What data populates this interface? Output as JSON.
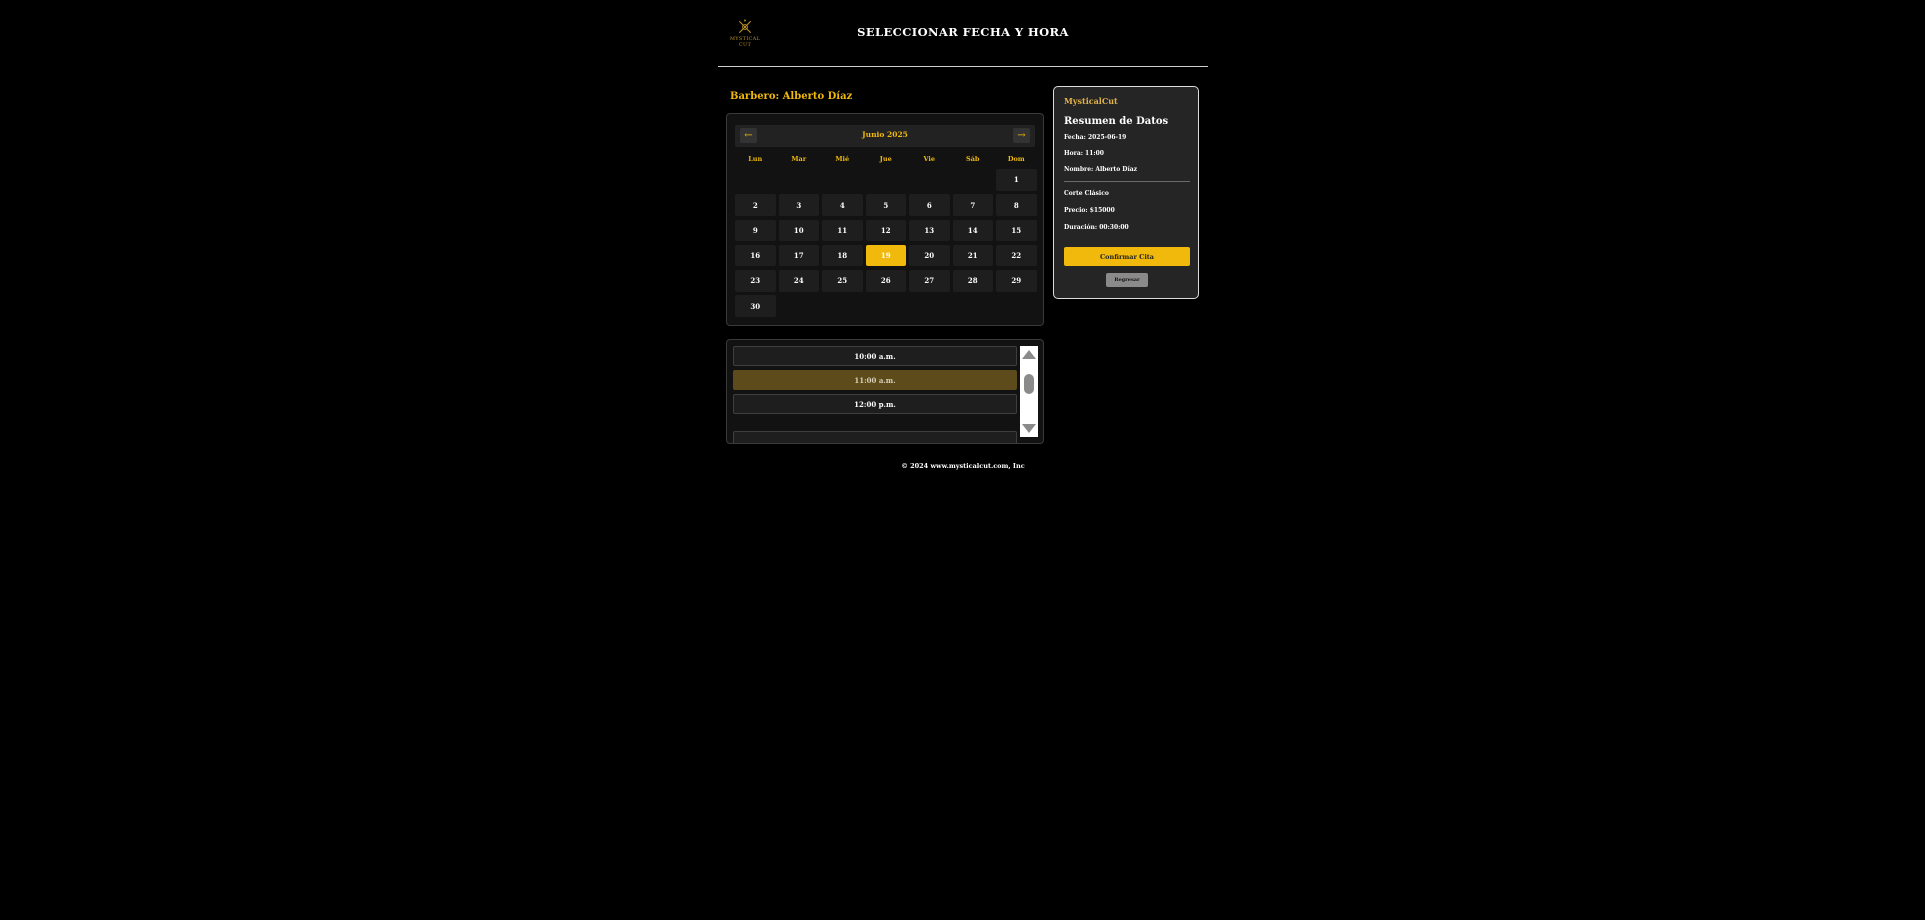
{
  "header": {
    "logo_text": [
      "MYSTICAL",
      "CUT"
    ],
    "title": "SELECCIONAR FECHA Y HORA"
  },
  "barber": {
    "title": "Barbero: Alberto Díaz"
  },
  "calendar": {
    "prev_icon": "←",
    "next_icon": "→",
    "month": "Junio 2025",
    "weekdays": [
      "Lun",
      "Mar",
      "Mié",
      "Jue",
      "Vie",
      "Sáb",
      "Dom"
    ],
    "first_weekday_index": 6,
    "days": [
      "1",
      "2",
      "3",
      "4",
      "5",
      "6",
      "7",
      "8",
      "9",
      "10",
      "11",
      "12",
      "13",
      "14",
      "15",
      "16",
      "17",
      "18",
      "19",
      "20",
      "21",
      "22",
      "23",
      "24",
      "25",
      "26",
      "27",
      "28",
      "29",
      "30"
    ],
    "selected_day": "19"
  },
  "times": {
    "slots": [
      "10:00 a.m.",
      "11:00 a.m.",
      "12:00 p.m."
    ],
    "selected": "11:00 a.m."
  },
  "summary": {
    "brand": "MysticalCut",
    "title": "Resumen de Datos",
    "fecha": "Fecha: 2025-06-19",
    "hora": "Hora: 11:00",
    "nombre": "Nombre: Alberto Díaz",
    "servicio": "Corte Clásico",
    "precio": "Precio: $15000",
    "duracion": "Duración: 00:30:00",
    "confirm_label": "Confirmar Cita",
    "back_label": "Regresar"
  },
  "footer": {
    "text": "© 2024 www.mysticalcut.com, Inc"
  },
  "colors": {
    "background": "#000000",
    "accent": "#f0b90c",
    "panel": "#252525",
    "selected_slot": "#5e4b1c"
  }
}
